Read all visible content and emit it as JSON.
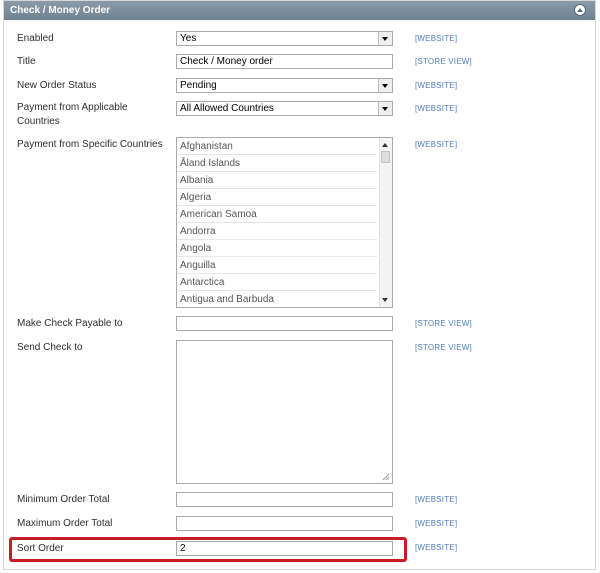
{
  "section": {
    "title": "Check / Money Order"
  },
  "fields": {
    "enabled": {
      "label": "Enabled",
      "value": "Yes",
      "scope": "[WEBSITE]"
    },
    "title": {
      "label": "Title",
      "value": "Check / Money order",
      "scope": "[STORE VIEW]"
    },
    "new_order_status": {
      "label": "New Order Status",
      "value": "Pending",
      "scope": "[WEBSITE]"
    },
    "applicable_countries": {
      "label_line1": "Payment from Applicable",
      "label_line2": "Countries",
      "value": "All Allowed Countries",
      "scope": "[WEBSITE]"
    },
    "specific_countries": {
      "label": "Payment from Specific Countries",
      "scope": "[WEBSITE]",
      "options": [
        "Afghanistan",
        "Åland Islands",
        "Albania",
        "Algeria",
        "American Samoa",
        "Andorra",
        "Angola",
        "Anguilla",
        "Antarctica",
        "Antigua and Barbuda"
      ]
    },
    "payable_to": {
      "label": "Make Check Payable to",
      "value": "",
      "scope": "[STORE VIEW]"
    },
    "send_check_to": {
      "label": "Send Check to",
      "value": "",
      "scope": "[STORE VIEW]"
    },
    "min_total": {
      "label": "Minimum Order Total",
      "value": "",
      "scope": "[WEBSITE]"
    },
    "max_total": {
      "label": "Maximum Order Total",
      "value": "",
      "scope": "[WEBSITE]"
    },
    "sort_order": {
      "label": "Sort Order",
      "value": "2",
      "scope": "[WEBSITE]"
    }
  },
  "colors": {
    "header": "#7b8d9c",
    "scope_link": "#4e7ec0",
    "highlight": "#c81d25"
  },
  "icons": {
    "collapse": "collapse-up-icon",
    "resize": "resize-grip-icon"
  }
}
